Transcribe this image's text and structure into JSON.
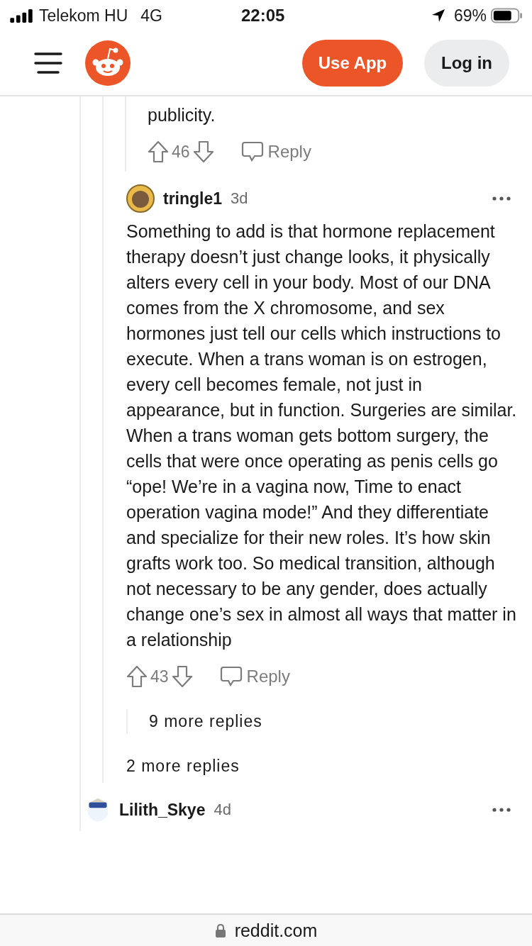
{
  "status_bar": {
    "carrier": "Telekom HU",
    "network": "4G",
    "time": "22:05",
    "battery": "69%"
  },
  "header": {
    "buttons": [
      {
        "label": "Use App",
        "kind": "primary"
      },
      {
        "label": "Log in",
        "kind": "secondary"
      }
    ]
  },
  "previous_comment": {
    "text": "publicity.",
    "score": "46",
    "reply": "Reply"
  },
  "comment": {
    "author": "tringle1",
    "age": "3d",
    "body": "Something to add is that hormone replacement therapy doesn’t just change looks, it physically alters every cell in your body. Most of our DNA comes from the X chromosome, and sex hormones just tell our cells which instructions to execute. When a trans woman is on estrogen, every cell becomes female, not just in appearance, but in function. Surgeries are similar. When a trans woman gets bottom surgery, the cells that were once operating as penis cells go “ope! We’re in a vagina now, Time to enact operation vagina mode!” And they differentiate and specialize for their new roles. It’s how skin grafts work too. So medical transition, although not necessary to be any gender, does actually change one’s sex in almost all ways that matter in a relationship",
    "score": "43",
    "reply": "Reply",
    "more_replies": "9 more replies"
  },
  "thread_more_replies": "2 more replies",
  "next_comment": {
    "author": "Lilith_Skye",
    "age": "4d"
  },
  "address_bar": {
    "domain": "reddit.com"
  }
}
